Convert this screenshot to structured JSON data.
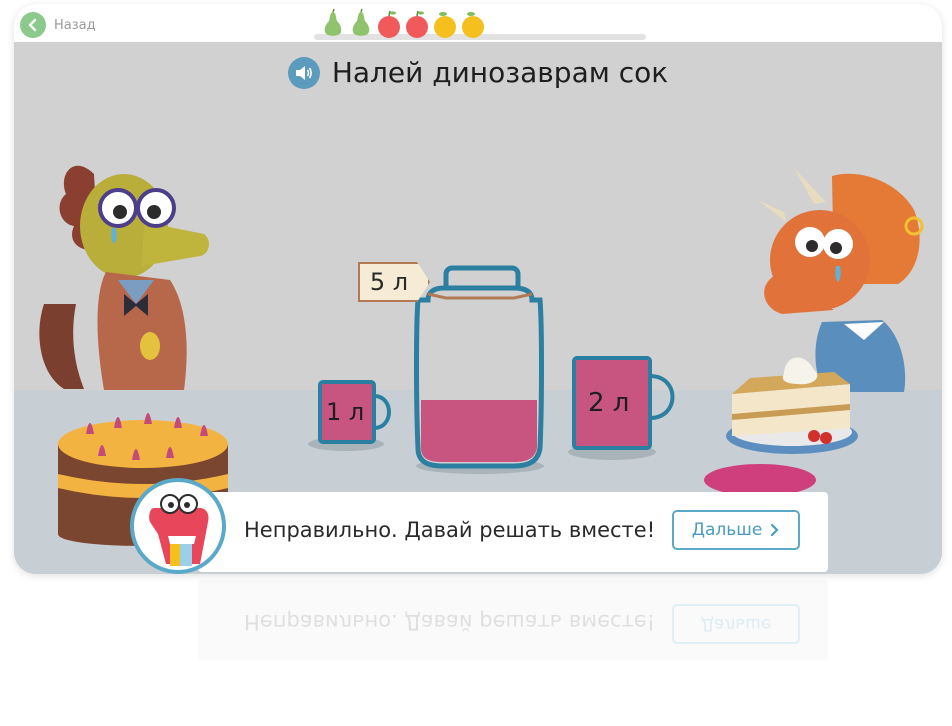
{
  "header": {
    "back_label": "Назад",
    "fruits": [
      {
        "kind": "pear",
        "color": "#8fc46c"
      },
      {
        "kind": "pear",
        "color": "#8fc46c"
      },
      {
        "kind": "apple",
        "color": "#f05a5a"
      },
      {
        "kind": "apple",
        "color": "#f05a5a"
      },
      {
        "kind": "orange",
        "color": "#f5c01e"
      },
      {
        "kind": "orange",
        "color": "#f5c01e"
      }
    ]
  },
  "task": {
    "title": "Налей динозаврам сок",
    "sound_icon": "speaker-icon"
  },
  "containers": {
    "small_cup_label": "1 л",
    "jar_label": "5 л",
    "big_cup_label": "2 л",
    "juice_color": "#c8557f"
  },
  "feedback": {
    "message": "Неправильно. Давай решать вместе!",
    "next_label": "Дальше"
  },
  "colors": {
    "accent": "#5aa9c8",
    "container_outline": "#2b7fa0",
    "background": "#d1d1d1"
  }
}
